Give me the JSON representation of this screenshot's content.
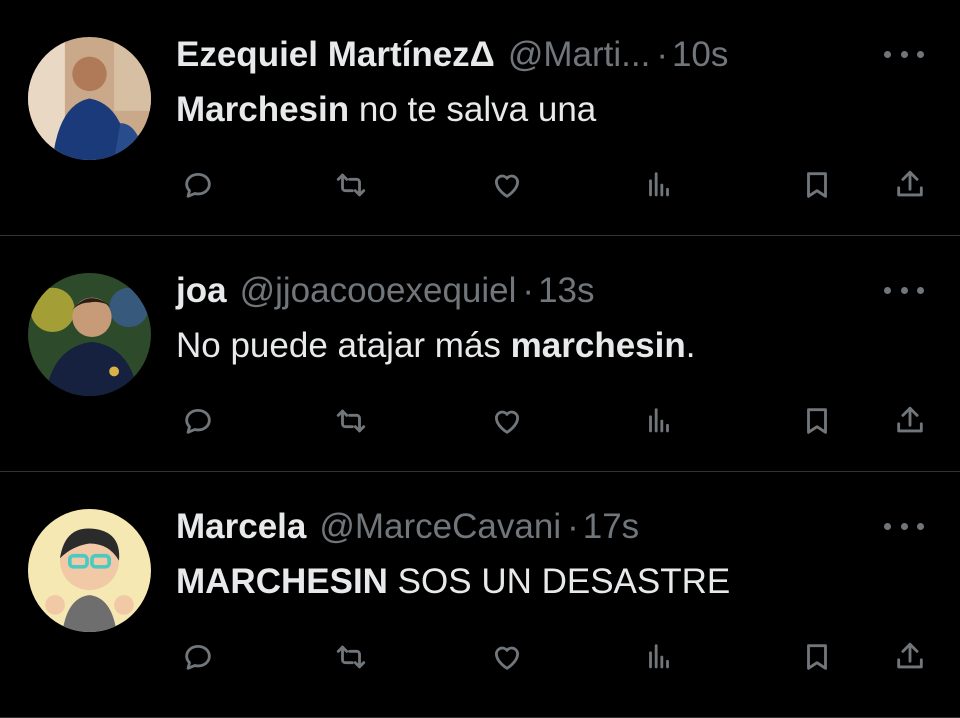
{
  "tweets": [
    {
      "name": "Ezequiel MartínezΔ",
      "handle": "@Marti...",
      "separator": "·",
      "time": "10s",
      "text_bold": "Marchesin",
      "text_rest": " no te salva una",
      "text_prefix": ""
    },
    {
      "name": "joa",
      "handle": "@jjoacooexequiel",
      "separator": "·",
      "time": "13s",
      "text_prefix": "No puede atajar más ",
      "text_bold": "marchesin",
      "text_rest": "."
    },
    {
      "name": "Marcela",
      "handle": "@MarceCavani",
      "separator": "·",
      "time": "17s",
      "text_prefix": "",
      "text_bold": "MARCHESIN",
      "text_rest": " SOS UN DESASTRE"
    }
  ],
  "icons": {
    "reply": "reply-icon",
    "retweet": "retweet-icon",
    "like": "like-icon",
    "views": "views-icon",
    "bookmark": "bookmark-icon",
    "share": "share-icon",
    "more": "more-icon"
  },
  "colors": {
    "background": "#000000",
    "text": "#e7e9ea",
    "secondary": "#71767b",
    "divider": "#2f3336"
  }
}
